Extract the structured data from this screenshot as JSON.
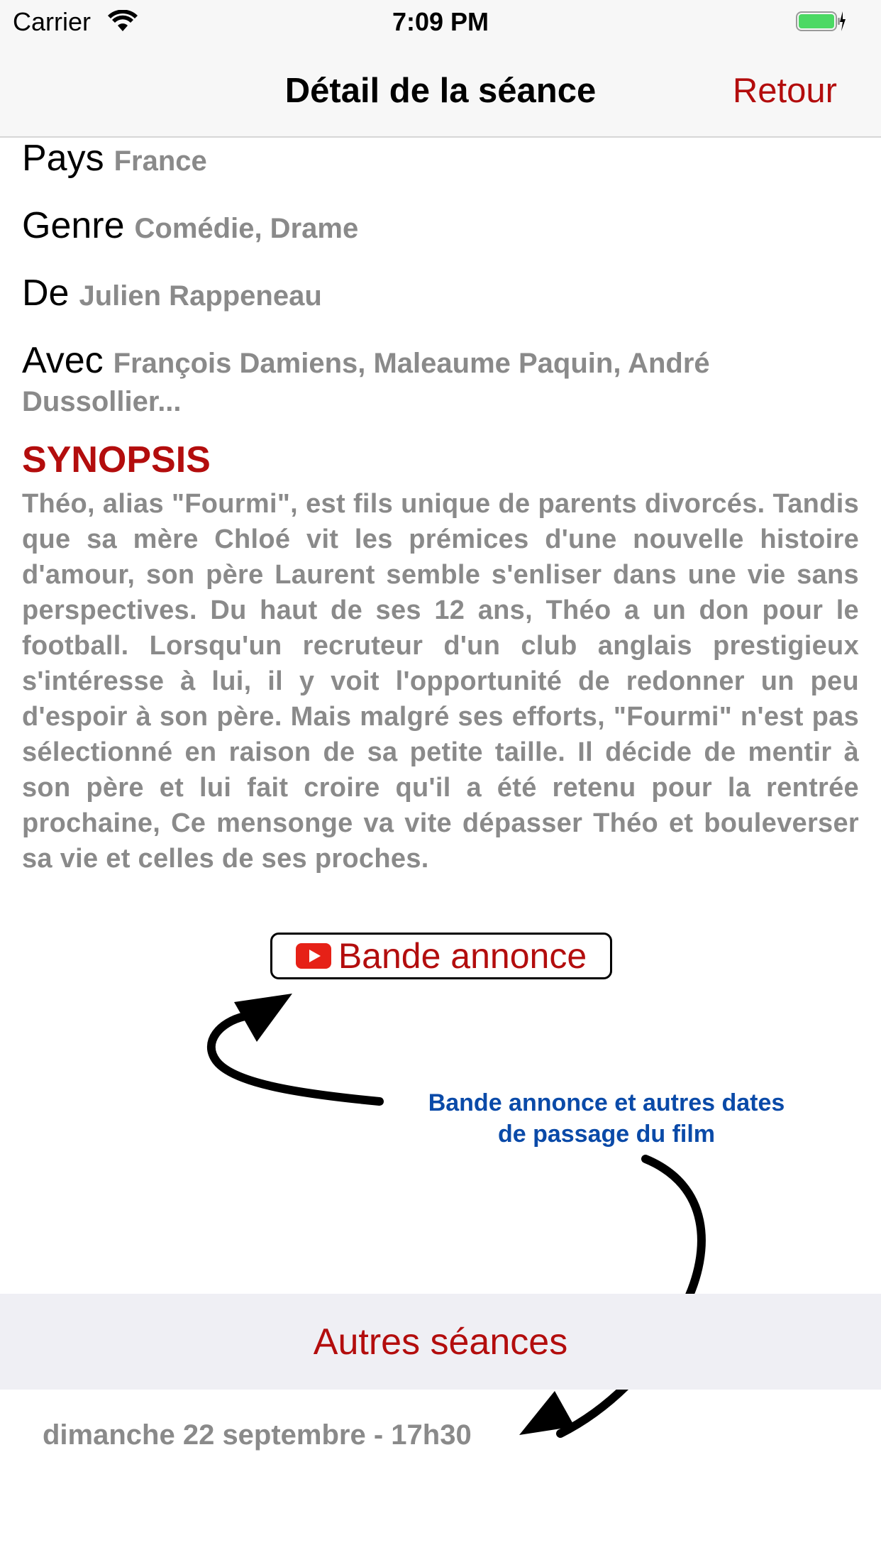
{
  "status_bar": {
    "carrier": "Carrier",
    "time": "7:09 PM"
  },
  "nav": {
    "title": "Détail de la séance",
    "back_label": "Retour"
  },
  "details": {
    "pays_label": "Pays",
    "pays_value": "France",
    "genre_label": "Genre",
    "genre_value": "Comédie, Drame",
    "de_label": "De",
    "de_value": "Julien Rappeneau",
    "avec_label": "Avec",
    "avec_value": "François Damiens, Maleaume Paquin, André Dussollier..."
  },
  "synopsis": {
    "title": "SYNOPSIS",
    "text": "Théo, alias \"Fourmi\", est fils unique de parents divorcés. Tandis que sa mère Chloé vit les prémices d'une nouvelle histoire d'amour, son père Laurent semble s'enliser dans une vie sans perspectives. Du haut de ses 12 ans, Théo a un don pour le football. Lorsqu'un recruteur d'un club anglais prestigieux s'intéresse à lui, il y voit l'opportunité de redonner un peu d'espoir à son père. Mais malgré ses efforts, \"Fourmi\" n'est pas sélectionné en raison de sa petite taille. Il décide de mentir à son père et lui fait croire qu'il a été retenu pour la rentrée prochaine, Ce mensonge va vite dépasser Théo et bouleverser sa vie et celles de ses proches."
  },
  "trailer": {
    "label": "Bande annonce",
    "icon": "youtube-icon"
  },
  "annotation": {
    "line1": "Bande annonce et autres dates",
    "line2": "de passage du film"
  },
  "other_sessions": {
    "title": "Autres séances",
    "items": [
      "dimanche 22 septembre - 17h30"
    ]
  },
  "colors": {
    "accent": "#b30d0d",
    "annotation": "#0a4aa8",
    "muted_text": "#8a8a8a"
  }
}
